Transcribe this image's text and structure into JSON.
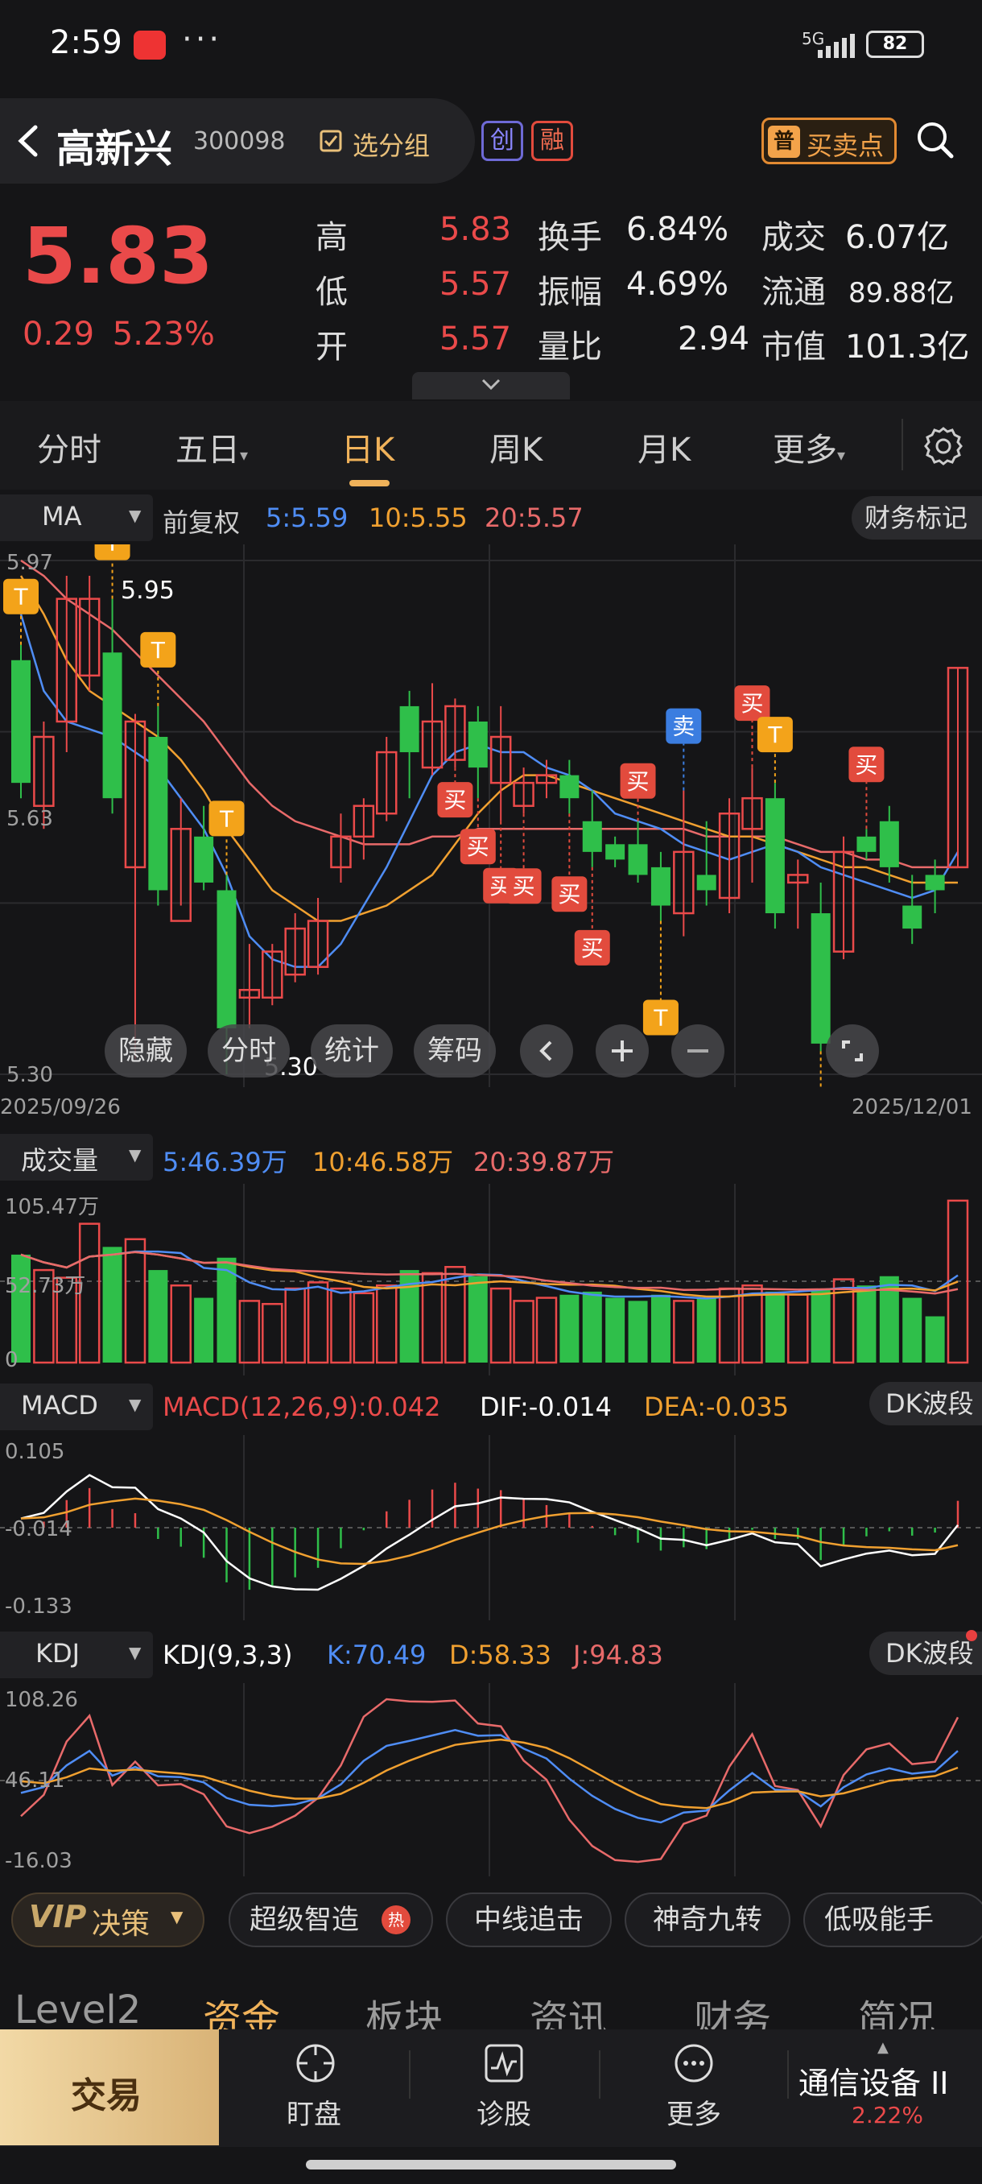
{
  "status_bar": {
    "time": "2:59",
    "dots": "···",
    "network": "5G",
    "battery": "82"
  },
  "header": {
    "stock_name": "高新兴",
    "stock_code": "300098",
    "select_group": "选分组",
    "tag_chuang": "创",
    "tag_rong": "融",
    "buy_sell_badge": "普",
    "buy_sell_label": "买卖点"
  },
  "quote": {
    "price": "5.83",
    "change": "0.29",
    "change_pct": "5.23%",
    "high_label": "高",
    "high": "5.83",
    "low_label": "低",
    "low": "5.57",
    "open_label": "开",
    "open": "5.57",
    "turnover_label": "换手",
    "turnover": "6.84%",
    "amplitude_label": "振幅",
    "amplitude": "4.69%",
    "volume_ratio_label": "量比",
    "volume_ratio": "2.94",
    "amount_label": "成交",
    "amount": "6.07亿",
    "float_label": "流通",
    "float_value": "89.88亿",
    "mcap_label": "市值",
    "mcap": "101.3亿"
  },
  "period_tabs": [
    "分时",
    "五日",
    "日K",
    "周K",
    "月K",
    "更多"
  ],
  "active_tab": "日K",
  "ma_bar": {
    "selector": "MA",
    "adjust": "前复权",
    "ma5": "5:5.59",
    "ma10": "10:5.55",
    "ma20": "20:5.57",
    "finance": "财务标记"
  },
  "price_axis": {
    "top": "5.97",
    "mid": "5.63",
    "bottom": "5.30",
    "max_mark": "5.95",
    "min_mark": "5.30"
  },
  "date_range": {
    "start": "2025/09/26",
    "end": "2025/12/01"
  },
  "chart_tools": [
    "隐藏",
    "分时",
    "统计",
    "筹码"
  ],
  "volume_bar": {
    "label": "成交量",
    "v5": "5:46.39万",
    "v10": "10:46.58万",
    "v20": "20:39.87万",
    "axis_top": "105.47万",
    "axis_mid": "52.73万",
    "axis_zero": "0"
  },
  "macd_bar": {
    "label": "MACD",
    "params": "MACD(12,26,9):0.042",
    "dif": "DIF:-0.014",
    "dea": "DEA:-0.035",
    "right": "DK波段",
    "axis_top": "0.105",
    "axis_mid": "-0.014",
    "axis_bottom": "-0.133"
  },
  "kdj_bar": {
    "label": "KDJ",
    "params": "KDJ(9,3,3)",
    "k": "K:70.49",
    "d": "D:58.33",
    "j": "J:94.83",
    "right": "DK波段",
    "axis_top": "108.26",
    "axis_mid": "46.11",
    "axis_bottom": "-16.03"
  },
  "vip_row": {
    "vip": "VIP",
    "vip_label": "决策",
    "chips": [
      "超级智造",
      "中线追击",
      "神奇九转",
      "低吸能手"
    ],
    "hot": "热"
  },
  "info_tabs": [
    "Level2",
    "资金",
    "板块",
    "资讯",
    "财务",
    "简况"
  ],
  "bottom_nav": {
    "trade": "交易",
    "watch": "盯盘",
    "diagnose": "诊股",
    "more": "更多",
    "sector": "通信设备 II",
    "sector_change": "2.22%"
  },
  "signals": {
    "t": "T",
    "buy": "买",
    "sell": "卖"
  },
  "colors": {
    "red": "#ea4a4a",
    "green": "#2fbf4a",
    "ma5": "#4f8df5",
    "ma10": "#f0a030",
    "ma20": "#e86a6a",
    "gold": "#f0b25a"
  },
  "chart_data": {
    "type": "candlestick",
    "ylim": [
      5.3,
      5.97
    ],
    "candles": [
      {
        "o": 5.84,
        "c": 5.68,
        "h": 5.86,
        "l": 5.66
      },
      {
        "o": 5.65,
        "c": 5.74,
        "h": 5.76,
        "l": 5.62
      },
      {
        "o": 5.76,
        "c": 5.92,
        "h": 5.95,
        "l": 5.72
      },
      {
        "o": 5.82,
        "c": 5.92,
        "h": 5.95,
        "l": 5.8
      },
      {
        "o": 5.85,
        "c": 5.66,
        "h": 5.92,
        "l": 5.64
      },
      {
        "o": 5.57,
        "c": 5.76,
        "h": 5.77,
        "l": 5.32
      },
      {
        "o": 5.74,
        "c": 5.54,
        "h": 5.78,
        "l": 5.52
      },
      {
        "o": 5.5,
        "c": 5.62,
        "h": 5.66,
        "l": 5.52
      },
      {
        "o": 5.61,
        "c": 5.55,
        "h": 5.65,
        "l": 5.54
      },
      {
        "o": 5.54,
        "c": 5.36,
        "h": 5.56,
        "l": 5.3
      },
      {
        "o": 5.4,
        "c": 5.41,
        "h": 5.47,
        "l": 5.36
      },
      {
        "o": 5.4,
        "c": 5.46,
        "h": 5.47,
        "l": 5.39
      },
      {
        "o": 5.43,
        "c": 5.49,
        "h": 5.51,
        "l": 5.42
      },
      {
        "o": 5.44,
        "c": 5.5,
        "h": 5.53,
        "l": 5.43
      },
      {
        "o": 5.57,
        "c": 5.61,
        "h": 5.64,
        "l": 5.55
      },
      {
        "o": 5.61,
        "c": 5.65,
        "h": 5.66,
        "l": 5.58
      },
      {
        "o": 5.64,
        "c": 5.72,
        "h": 5.74,
        "l": 5.63
      },
      {
        "o": 5.78,
        "c": 5.72,
        "h": 5.8,
        "l": 5.66
      },
      {
        "o": 5.7,
        "c": 5.76,
        "h": 5.81,
        "l": 5.69
      },
      {
        "o": 5.71,
        "c": 5.78,
        "h": 5.79,
        "l": 5.7
      },
      {
        "o": 5.76,
        "c": 5.7,
        "h": 5.78,
        "l": 5.66
      },
      {
        "o": 5.68,
        "c": 5.74,
        "h": 5.78,
        "l": 5.63
      },
      {
        "o": 5.65,
        "c": 5.68,
        "h": 5.7,
        "l": 5.64
      },
      {
        "o": 5.68,
        "c": 5.69,
        "h": 5.71,
        "l": 5.66
      },
      {
        "o": 5.69,
        "c": 5.66,
        "h": 5.71,
        "l": 5.64
      },
      {
        "o": 5.63,
        "c": 5.59,
        "h": 5.67,
        "l": 5.57
      },
      {
        "o": 5.6,
        "c": 5.58,
        "h": 5.61,
        "l": 5.57
      },
      {
        "o": 5.6,
        "c": 5.56,
        "h": 5.63,
        "l": 5.55
      },
      {
        "o": 5.57,
        "c": 5.52,
        "h": 5.59,
        "l": 5.5
      },
      {
        "o": 5.51,
        "c": 5.59,
        "h": 5.67,
        "l": 5.48
      },
      {
        "o": 5.56,
        "c": 5.54,
        "h": 5.63,
        "l": 5.52
      },
      {
        "o": 5.53,
        "c": 5.64,
        "h": 5.66,
        "l": 5.51
      },
      {
        "o": 5.62,
        "c": 5.66,
        "h": 5.7,
        "l": 5.55
      },
      {
        "o": 5.66,
        "c": 5.51,
        "h": 5.68,
        "l": 5.49
      },
      {
        "o": 5.55,
        "c": 5.56,
        "h": 5.58,
        "l": 5.49
      },
      {
        "o": 5.51,
        "c": 5.34,
        "h": 5.55,
        "l": 5.33
      },
      {
        "o": 5.46,
        "c": 5.59,
        "h": 5.61,
        "l": 5.45
      },
      {
        "o": 5.61,
        "c": 5.59,
        "h": 5.62,
        "l": 5.58
      },
      {
        "o": 5.63,
        "c": 5.57,
        "h": 5.65,
        "l": 5.55
      },
      {
        "o": 5.52,
        "c": 5.49,
        "h": 5.56,
        "l": 5.47
      },
      {
        "o": 5.56,
        "c": 5.54,
        "h": 5.58,
        "l": 5.51
      },
      {
        "o": 5.57,
        "c": 5.83,
        "h": 5.83,
        "l": 5.57
      }
    ],
    "ma5": [
      5.9,
      5.8,
      5.76,
      5.75,
      5.74,
      5.72,
      5.7,
      5.66,
      5.62,
      5.56,
      5.48,
      5.45,
      5.44,
      5.44,
      5.47,
      5.52,
      5.57,
      5.63,
      5.69,
      5.72,
      5.73,
      5.72,
      5.72,
      5.7,
      5.69,
      5.67,
      5.64,
      5.63,
      5.62,
      5.6,
      5.59,
      5.58,
      5.59,
      5.6,
      5.59,
      5.57,
      5.56,
      5.55,
      5.54,
      5.53,
      5.54,
      5.59
    ],
    "ma10": [
      5.95,
      5.9,
      5.84,
      5.8,
      5.78,
      5.76,
      5.74,
      5.71,
      5.67,
      5.62,
      5.58,
      5.54,
      5.52,
      5.5,
      5.5,
      5.51,
      5.52,
      5.54,
      5.56,
      5.6,
      5.64,
      5.67,
      5.69,
      5.69,
      5.68,
      5.67,
      5.66,
      5.65,
      5.64,
      5.63,
      5.62,
      5.61,
      5.61,
      5.6,
      5.59,
      5.58,
      5.57,
      5.57,
      5.56,
      5.55,
      5.55,
      5.55
    ],
    "ma20": [
      5.97,
      5.95,
      5.92,
      5.9,
      5.88,
      5.85,
      5.82,
      5.79,
      5.76,
      5.72,
      5.68,
      5.65,
      5.63,
      5.62,
      5.61,
      5.6,
      5.6,
      5.6,
      5.61,
      5.61,
      5.62,
      5.62,
      5.62,
      5.62,
      5.62,
      5.62,
      5.62,
      5.62,
      5.62,
      5.62,
      5.61,
      5.61,
      5.61,
      5.61,
      5.6,
      5.59,
      5.59,
      5.58,
      5.58,
      5.57,
      5.57,
      5.57
    ],
    "volume": [
      70,
      60,
      55,
      90,
      75,
      80,
      60,
      50,
      42,
      68,
      40,
      38,
      48,
      52,
      48,
      45,
      50,
      60,
      58,
      62,
      56,
      48,
      40,
      42,
      44,
      46,
      42,
      40,
      44,
      40,
      42,
      48,
      50,
      46,
      44,
      48,
      54,
      50,
      56,
      42,
      30,
      105
    ]
  }
}
